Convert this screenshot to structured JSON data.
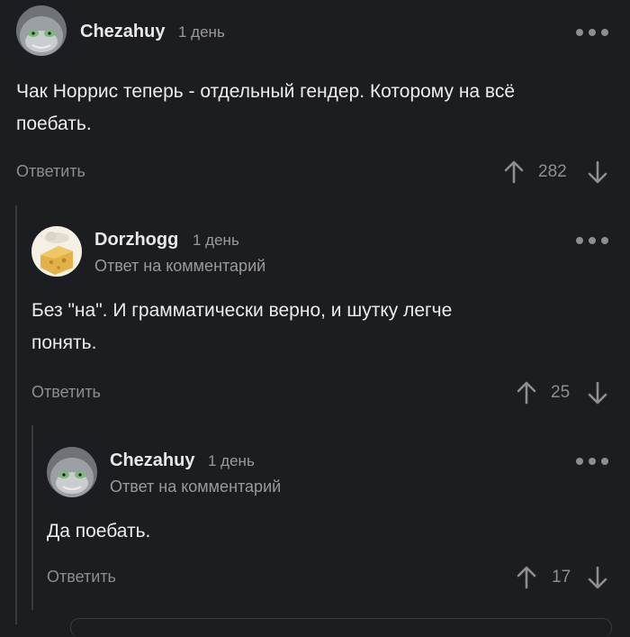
{
  "comments": [
    {
      "username": "Chezahuy",
      "time": "1 день",
      "subtitle": "",
      "text_line1": "Чак Норрис теперь - отдельный гендер. Которому на всё",
      "text_line2": "поебать.",
      "reply_label": "Ответить",
      "rating": "282"
    },
    {
      "username": "Dorzhogg",
      "time": "1 день",
      "subtitle": "Ответ на комментарий",
      "text_line1": "Без \"на\". И грамматически верно, и шутку легче",
      "text_line2": "понять.",
      "reply_label": "Ответить",
      "rating": "25"
    },
    {
      "username": "Chezahuy",
      "time": "1 день",
      "subtitle": "Ответ на комментарий",
      "text_line1": "Да поебать.",
      "text_line2": "",
      "reply_label": "Ответить",
      "rating": "17"
    }
  ],
  "icons": {
    "more": "more-dots-icon",
    "upvote": "arrow-up-icon",
    "downvote": "arrow-down-icon"
  },
  "colors": {
    "background": "#1c1d20",
    "muted_text": "#8e8e92",
    "thread_line": "#3a3b3f"
  }
}
